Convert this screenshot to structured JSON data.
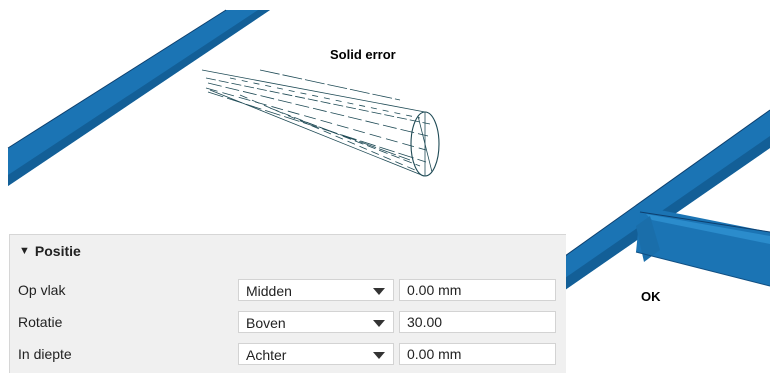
{
  "viewport": {
    "solid_error_label": "Solid error",
    "ok_label": "OK",
    "pipe_color": "#1b74b4",
    "pipe_edge_color": "#0d3f6e",
    "wire_color": "#1e4a55"
  },
  "panel": {
    "section_title": "Positie",
    "collapse_icon": "triangle-down-icon",
    "rows": [
      {
        "label": "Op vlak",
        "select_value": "Midden",
        "input_value": "0.00 mm"
      },
      {
        "label": "Rotatie",
        "select_value": "Boven",
        "input_value": "30.00"
      },
      {
        "label": "In diepte",
        "select_value": "Achter",
        "input_value": "0.00 mm"
      }
    ]
  }
}
